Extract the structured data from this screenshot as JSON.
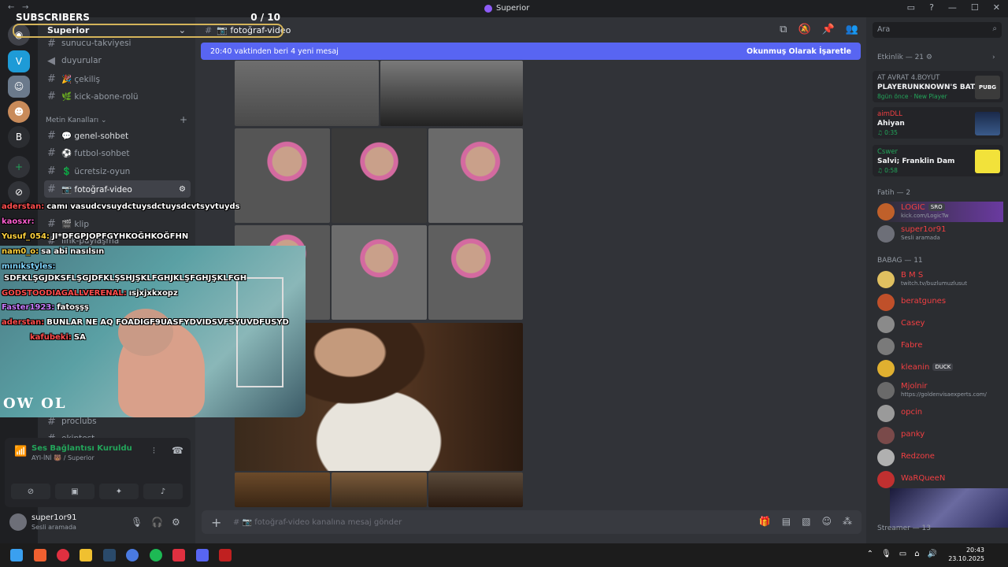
{
  "window": {
    "title": "Superior",
    "back": "←",
    "forward": "→"
  },
  "overlay": {
    "subscribers_label": "SUBSCRIBERS",
    "subscribers_count": "0 / 10"
  },
  "server": {
    "name": "Superior"
  },
  "sidebar": {
    "channels_top": [
      {
        "label": "sunucu-takviyesi",
        "icon": "hash"
      },
      {
        "label": "duyurular",
        "icon": "megaphone"
      },
      {
        "label": "🎉 çekiliş",
        "icon": "hash"
      },
      {
        "label": "🌿 kick-abone-rolü",
        "icon": "hash"
      }
    ],
    "category": "Metin Kanalları",
    "channels": [
      {
        "label": "💬 genel-sohbet"
      },
      {
        "label": "⚽ futbol-sohbet"
      },
      {
        "label": "💲 ücretsiz-oyun"
      },
      {
        "label": "📷 fotoğraf-video"
      },
      {
        "label": "🎬 klip"
      },
      {
        "label": "link-paylaşma"
      }
    ],
    "channels_bottom": [
      {
        "label": "proclubs"
      },
      {
        "label": "ekiptest"
      }
    ]
  },
  "voice": {
    "status": "Ses Bağlantısı Kuruldu",
    "location": "AYI-İNİ 🐻 / Superior"
  },
  "user": {
    "name": "super1or91",
    "status": "Sesli aramada"
  },
  "header": {
    "channel": "📷 fotoğraf-video"
  },
  "newbar": {
    "left": "20:40 vaktinden beri 4 yeni mesaj",
    "right": "Okunmuş Olarak İşaretle"
  },
  "composer": {
    "placeholder": "# 📷 fotoğraf-video kanalına mesaj gönder"
  },
  "members": {
    "search_placeholder": "Ara",
    "activity_header": "Etkinlik — 21",
    "activities": [
      {
        "line1": "AT AVRAT 4.BOYUT",
        "line2": "PLAYERUNKNOWN'S BAT...",
        "line3": "8gün önce · New Player",
        "thumb": "PUBG"
      },
      {
        "line1": "aimDLL",
        "line2": "Ahiyan",
        "line3": "♫ 0:35",
        "thumb": ""
      },
      {
        "line1": "Cswer",
        "line2": "Salvi; Franklin Dam",
        "line3": "♫ 0:58",
        "thumb": ""
      }
    ],
    "groups": [
      {
        "title": "Fatih — 2",
        "members": [
          {
            "name": "LOGIC",
            "status": "kick.com/LogicTw",
            "tag": "SRO"
          },
          {
            "name": "super1or91",
            "status": "Sesli aramada",
            "tag": ""
          }
        ]
      },
      {
        "title": "BABAG — 11",
        "members": [
          {
            "name": "B M S",
            "status": "twitch.tv/buzlumuzlusut",
            "tag": ""
          },
          {
            "name": "beratgunes",
            "status": "",
            "tag": ""
          },
          {
            "name": "Casey",
            "status": "",
            "tag": ""
          },
          {
            "name": "Fabre",
            "status": "",
            "tag": ""
          },
          {
            "name": "kleanin",
            "status": "",
            "tag": "DUCK"
          },
          {
            "name": "Mjolnir",
            "status": "https://goldenvisaexperts.com/",
            "tag": ""
          },
          {
            "name": "opcin",
            "status": "",
            "tag": ""
          },
          {
            "name": "panky",
            "status": "",
            "tag": ""
          },
          {
            "name": "Redzone",
            "status": "",
            "tag": ""
          },
          {
            "name": "WaRQueeN",
            "status": "",
            "tag": ""
          }
        ]
      }
    ],
    "streamer_header": "Streamer — 13"
  },
  "chat_overlay": [
    {
      "user": "aderstan:",
      "color": "#ff4d4d",
      "msg": "camı vasudcvsuydctuysdctuysdcvtsyvtuyds"
    },
    {
      "user": "kaosxr:",
      "color": "#ff5fd2",
      "msg": ""
    },
    {
      "user": "Yusuf_054:",
      "color": "#ffd23d",
      "msg": "JI*DFGPJOPFGYHKOĞHKOĞFHN"
    },
    {
      "user": "nam0_o:",
      "color": "#ffd23d",
      "msg": "sa abi nasılsın"
    },
    {
      "user": "mınıkstyles:",
      "color": "#7fd6ff",
      "msg": ""
    },
    {
      "user": "",
      "color": "#ffffff",
      "msg": "SDFKLŞGJDKSFLŞGJDFKLŞSHJŞKLFGHJKLŞFGHJŞKLFGH"
    },
    {
      "user": "GODSTOODIAGALLVERENAL:",
      "color": "#ff4d4d",
      "msg": "ısjxjxkxopz"
    },
    {
      "user": "Faster1923:",
      "color": "#c77dff",
      "msg": "fatoşşş"
    },
    {
      "user": "aderstan:",
      "color": "#ff4d4d",
      "msg": "BUNLAR NE AQ FOADIGF9UASFYDVIDSVFSYUVDFUSYD"
    },
    {
      "user": "kafubeki:",
      "color": "#ff4d4d",
      "msg": "SA"
    }
  ],
  "cam_logo": "OW OL",
  "taskbar": {
    "time": "20:43",
    "date": "23.10.2025"
  }
}
